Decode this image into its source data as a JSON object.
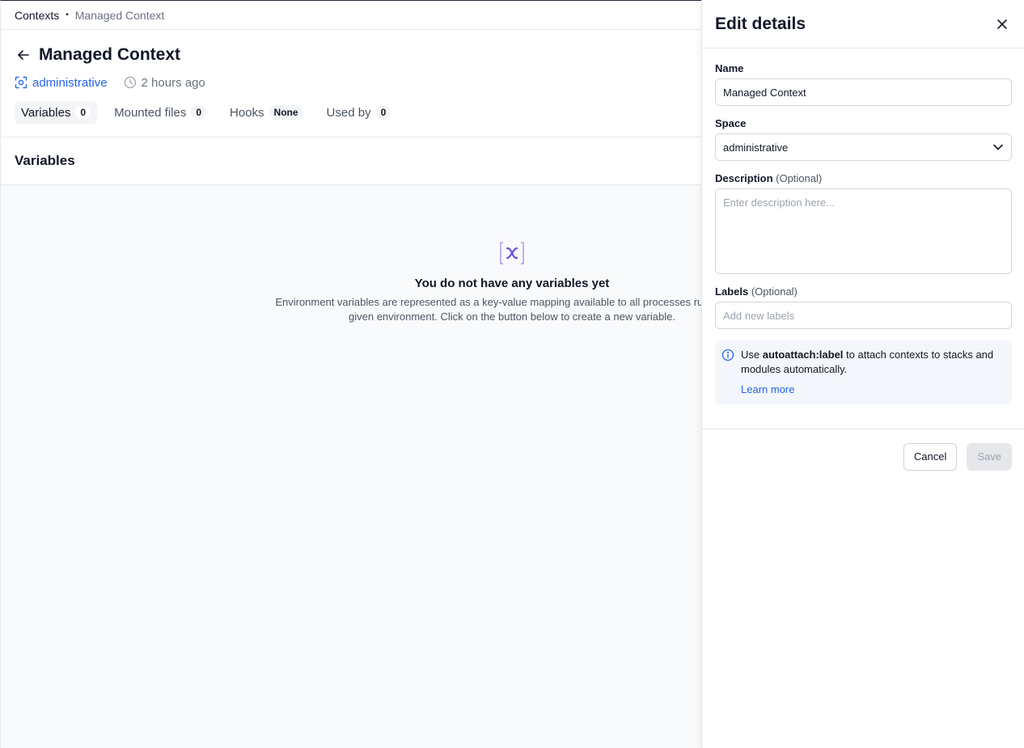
{
  "breadcrumb": {
    "root": "Contexts",
    "separator": "•",
    "current": "Managed Context"
  },
  "header": {
    "title": "Managed Context",
    "space": "administrative",
    "updated": "2 hours ago"
  },
  "tabs": [
    {
      "label": "Variables",
      "badge": "0",
      "active": true
    },
    {
      "label": "Mounted files",
      "badge": "0",
      "active": false
    },
    {
      "label": "Hooks",
      "badge": "None",
      "active": false
    },
    {
      "label": "Used by",
      "badge": "0",
      "active": false
    }
  ],
  "section": {
    "title": "Variables"
  },
  "empty_state": {
    "icon": "variable-icon",
    "title": "You do not have any variables yet",
    "description": "Environment variables are represented as a key-value mapping available to all processes running in a given environment. Click on the button below to create a new variable."
  },
  "drawer": {
    "title": "Edit details",
    "name_label": "Name",
    "name_value": "Managed Context",
    "space_label": "Space",
    "space_value": "administrative",
    "description_label": "Description",
    "description_optional": "(Optional)",
    "description_placeholder": "Enter description here...",
    "labels_label": "Labels",
    "labels_optional": "(Optional)",
    "labels_placeholder": "Add new labels",
    "info_prefix": "Use ",
    "info_keyword": "autoattach:label",
    "info_suffix": " to attach contexts to stacks and modules automatically.",
    "learn_more": "Learn more",
    "cancel_label": "Cancel",
    "save_label": "Save"
  },
  "colors": {
    "accent": "#2563eb",
    "icon_purple": "#6d4de6",
    "empty_bg": "#f9fafb",
    "info_bg": "#f3f6fa"
  }
}
